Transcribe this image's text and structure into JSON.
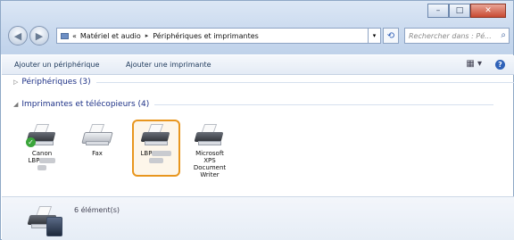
{
  "window": {
    "caption_buttons": [
      "–",
      "□",
      "✕"
    ]
  },
  "nav": {
    "back_icon": "back-arrow-icon",
    "forward_icon": "forward-arrow-icon"
  },
  "address": {
    "prefix": "«",
    "crumbs": [
      "Matériel et audio",
      "Périphériques et imprimantes"
    ],
    "separator": "▸",
    "dropdown": "▾",
    "refresh": "⟲"
  },
  "search": {
    "placeholder": "Rechercher dans : Pé...",
    "icon": "search-icon"
  },
  "toolbar": {
    "add_device": "Ajouter un périphérique",
    "add_printer": "Ajouter une imprimante",
    "view_icon": "▦ ▾",
    "help_icon": "?"
  },
  "groups": {
    "devices": "Périphériques (3)",
    "printers": "Imprimantes et télécopieurs (4)"
  },
  "printers": [
    {
      "line1": "Canon",
      "line2": "LBP"
    },
    {
      "line1": "Fax"
    },
    {
      "line1": "LBP"
    },
    {
      "line1": "Microsoft",
      "line2": "XPS",
      "line3": "Document",
      "line4": "Writer"
    }
  ],
  "details": {
    "count": "6 élément(s)"
  },
  "colors": {
    "selection": "#e8961e",
    "group_text": "#1e3287"
  }
}
